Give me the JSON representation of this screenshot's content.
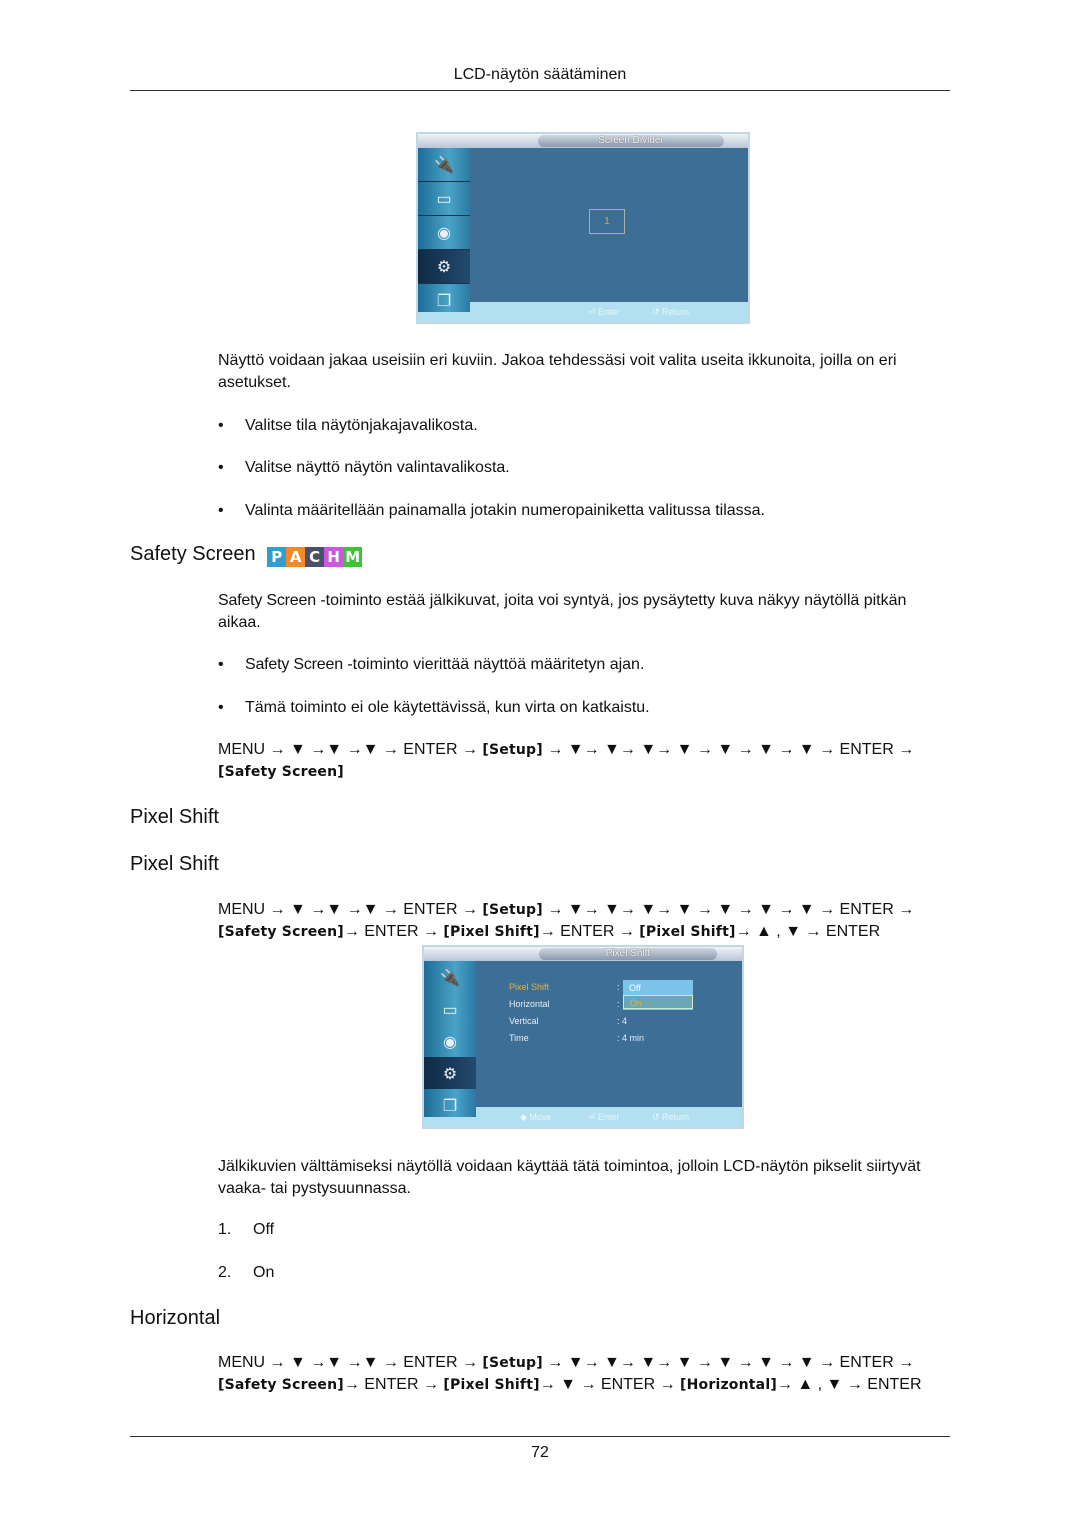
{
  "page": {
    "header_title": "LCD-näytön säätäminen",
    "page_number": "72"
  },
  "osd_screen_divider": {
    "title": "Screen Divider",
    "tabs": [
      "input-icon",
      "picture-icon",
      "sound-icon",
      "setup-icon",
      "multi-control-icon"
    ],
    "active_tab": 3,
    "selected_screen": "1",
    "footer": {
      "enter": "Enter",
      "return": "Return"
    },
    "colors": {
      "panel_bg": "#3d6e96",
      "highlight_text": "#d8a630",
      "footer_bg": "#b3e0f0"
    }
  },
  "intro": {
    "paragraph": "Näyttö voidaan jakaa useisiin eri kuviin. Jakoa tehdessäsi voit valita useita ikkunoita, joilla on eri asetukset.",
    "bullets": [
      "Valitse tila näytönjakajavalikosta.",
      "Valitse näyttö näytön valintavalikosta.",
      "Valinta määritellään painamalla jotakin numeropainiketta valitussa tilassa."
    ]
  },
  "safety_screen": {
    "heading": "Safety Screen",
    "mode_badges": [
      {
        "letter": "P",
        "color": "#2f9fd0"
      },
      {
        "letter": "A",
        "color": "#f28a2a"
      },
      {
        "letter": "C",
        "color": "#4a4f6a"
      },
      {
        "letter": "H",
        "color": "#c65adf"
      },
      {
        "letter": "M",
        "color": "#3fc23a"
      }
    ],
    "paragraph_term": "Safety Screen",
    "paragraph_rest": " -toiminto estää jälkikuvat, joita voi syntyä, jos pysäytetty kuva näkyy näytöllä pitkän aikaa.",
    "bullets": [
      {
        "term": "Safety Screen",
        "rest": " -toiminto vierittää näyttöä määritetyn ajan."
      },
      {
        "term": "",
        "rest": "Tämä toiminto ei ole käytettävissä, kun virta on katkaistu."
      }
    ],
    "path_line1": "MENU → ▼ →▼ →▼ → ENTER → ",
    "path_setup": "[Setup]",
    "path_line1b": " → ▼→ ▼→ ▼→ ▼ → ▼ → ▼ → ▼ → ENTER →",
    "path_line2": "[Safety Screen]"
  },
  "pixel_shift": {
    "heading_1": "Pixel Shift",
    "heading_2": "Pixel Shift",
    "path": {
      "l1a": "MENU → ▼ →▼ →▼ → ENTER → ",
      "setup": "[Setup]",
      "l1b": " → ▼→ ▼→ ▼→ ▼ → ▼ → ▼ → ▼ → ENTER →",
      "safety": "[Safety Screen]",
      "l2a": "→ ENTER → ",
      "pixel1": "[Pixel Shift]",
      "l2b": "→ ENTER → ",
      "pixel2": "[Pixel Shift]",
      "l2c": "→ ▲ , ▼ → ENTER"
    },
    "osd": {
      "title": "Pixel Shift",
      "items": [
        {
          "label": "Pixel Shift",
          "value": ":"
        },
        {
          "label": "Horizontal",
          "value": ":"
        },
        {
          "label": "Vertical",
          "value": ": 4"
        },
        {
          "label": "Time",
          "value": ": 4 min"
        }
      ],
      "dropdown_options": [
        "Off",
        "On"
      ],
      "dropdown_selected": "On",
      "footer": {
        "move": "Move",
        "enter": "Enter",
        "return": "Return"
      }
    },
    "paragraph": "Jälkikuvien välttämiseksi näytöllä voidaan käyttää tätä toimintoa, jolloin LCD-näytön pikselit siirtyvät vaaka- tai pystysuunnassa.",
    "options": [
      {
        "num": "1.",
        "label": "Off"
      },
      {
        "num": "2.",
        "label": "On"
      }
    ]
  },
  "horizontal": {
    "heading": "Horizontal",
    "path": {
      "l1a": "MENU → ▼ →▼ →▼ → ENTER → ",
      "setup": "[Setup]",
      "l1b": " → ▼→ ▼→ ▼→ ▼ → ▼ → ▼ → ▼ → ENTER →",
      "safety": "[Safety Screen]",
      "l2a": "→ ENTER → ",
      "pixel": "[Pixel Shift]",
      "l2b": "→ ▼ → ENTER → ",
      "horizontal": "[Horizontal]",
      "l2c": "→ ▲ , ▼ → ENTER"
    }
  }
}
